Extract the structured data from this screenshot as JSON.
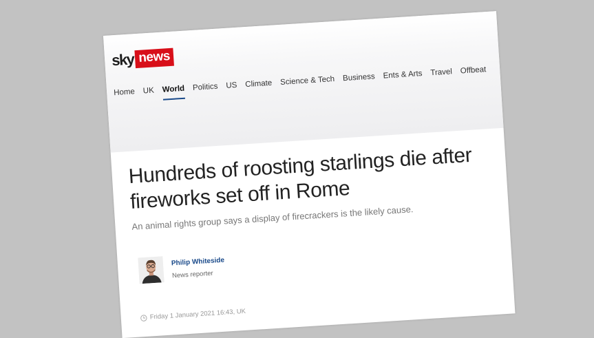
{
  "logo": {
    "sky": "sky",
    "news": "news"
  },
  "nav": {
    "items": [
      {
        "label": "Home"
      },
      {
        "label": "UK"
      },
      {
        "label": "World"
      },
      {
        "label": "Politics"
      },
      {
        "label": "US"
      },
      {
        "label": "Climate"
      },
      {
        "label": "Science & Tech"
      },
      {
        "label": "Business"
      },
      {
        "label": "Ents & Arts"
      },
      {
        "label": "Travel"
      },
      {
        "label": "Offbeat"
      }
    ],
    "active": "World"
  },
  "article": {
    "headline": "Hundreds of roosting starlings die after fireworks set off in Rome",
    "standfirst": "An animal rights group says a display of firecrackers is the likely cause."
  },
  "author": {
    "name": "Philip Whiteside",
    "role": "News reporter"
  },
  "timestamp": "Friday 1 January 2021 16:43, UK",
  "colors": {
    "brand_red": "#d80f19",
    "link_blue": "#1a4a8a",
    "background": "#c2c2c2"
  }
}
